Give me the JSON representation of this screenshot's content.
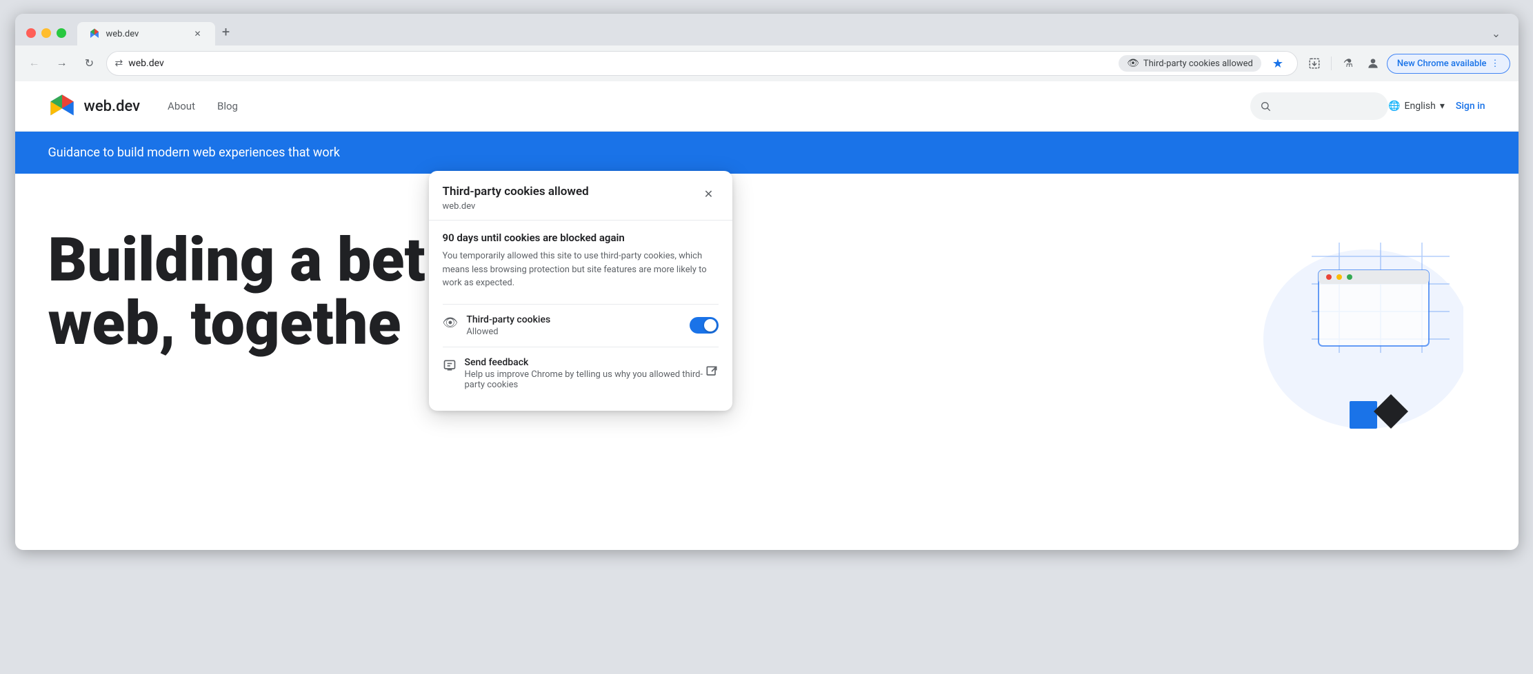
{
  "browser": {
    "tab": {
      "title": "web.dev",
      "favicon": "►"
    },
    "tab_new_label": "+",
    "maximize_icon": "⌄",
    "nav": {
      "back_label": "←",
      "forward_label": "→",
      "reload_label": "↻",
      "url": "web.dev",
      "omnibox_icon": "⇄",
      "cookies_pill_label": "Third-party cookies allowed",
      "star_icon": "★",
      "extensions_icon": "⬜",
      "flask_icon": "⚗",
      "profile_icon": "👤",
      "new_chrome_label": "New Chrome available",
      "new_chrome_icon": "⋮",
      "more_icon": "⋮"
    }
  },
  "site": {
    "logo_text": "web.dev",
    "nav_items": [
      "About",
      "Blog"
    ],
    "search_placeholder": "Search",
    "lang_label": "English",
    "lang_icon": "🌐",
    "lang_dropdown_icon": "▾",
    "signin_label": "Sign in"
  },
  "hero_banner": {
    "text": "Guidance to build modern web experiences that work"
  },
  "hero": {
    "title_line1": "Building a bet",
    "title_line2": "web, togethe"
  },
  "popup": {
    "title": "Third-party cookies allowed",
    "domain": "web.dev",
    "close_icon": "✕",
    "warning_title": "90 days until cookies are blocked again",
    "warning_text": "You temporarily allowed this site to use third-party cookies, which means less browsing protection but site features are more likely to work as expected.",
    "cookies_row": {
      "icon": "👁",
      "label": "Third-party cookies",
      "sub": "Allowed",
      "toggle_on": true
    },
    "feedback_row": {
      "icon": "💬",
      "label": "Send feedback",
      "sub": "Help us improve Chrome by telling us why you allowed third-party cookies",
      "external_icon": "⬡"
    }
  },
  "colors": {
    "blue": "#1a73e8",
    "light_blue_bg": "#e8f0fe",
    "border": "#dadce0",
    "text_dark": "#202124",
    "text_medium": "#3c4043",
    "text_light": "#5f6368"
  }
}
